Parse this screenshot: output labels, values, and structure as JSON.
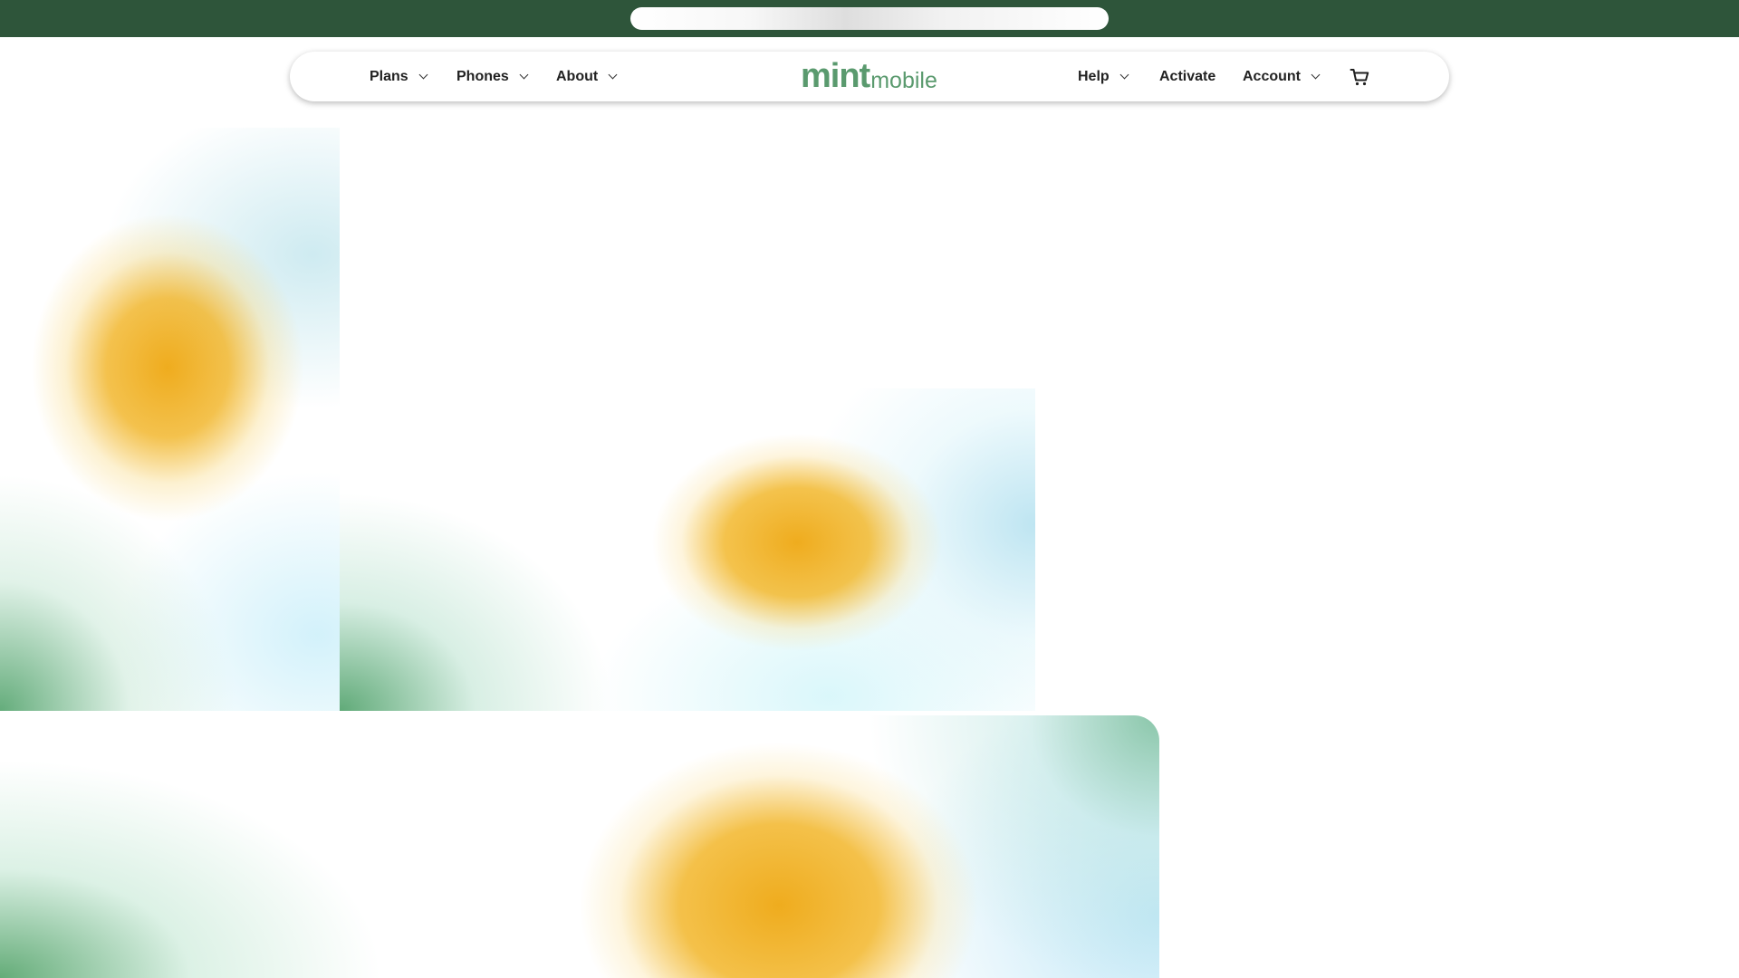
{
  "nav": {
    "left_items": [
      {
        "label": "Plans",
        "icon": "chevron-down-icon"
      },
      {
        "label": "Phones",
        "icon": "chevron-down-icon"
      },
      {
        "label": "About",
        "icon": "chevron-down-icon"
      }
    ],
    "logo": {
      "mint": "mint",
      "mobile": "mobile"
    },
    "right_items": [
      {
        "label": "Help",
        "icon": "chevron-down-icon"
      },
      {
        "label": "Activate"
      },
      {
        "label": "Account",
        "icon": "chevron-down-icon"
      }
    ],
    "cart_icon": "cart-icon"
  },
  "colors": {
    "topbar": "#2e553a",
    "logo": "#5a9a6e",
    "accent_yellow": "#efac1e",
    "accent_green": "#5ca874",
    "accent_blue": "#b7e2f0"
  }
}
